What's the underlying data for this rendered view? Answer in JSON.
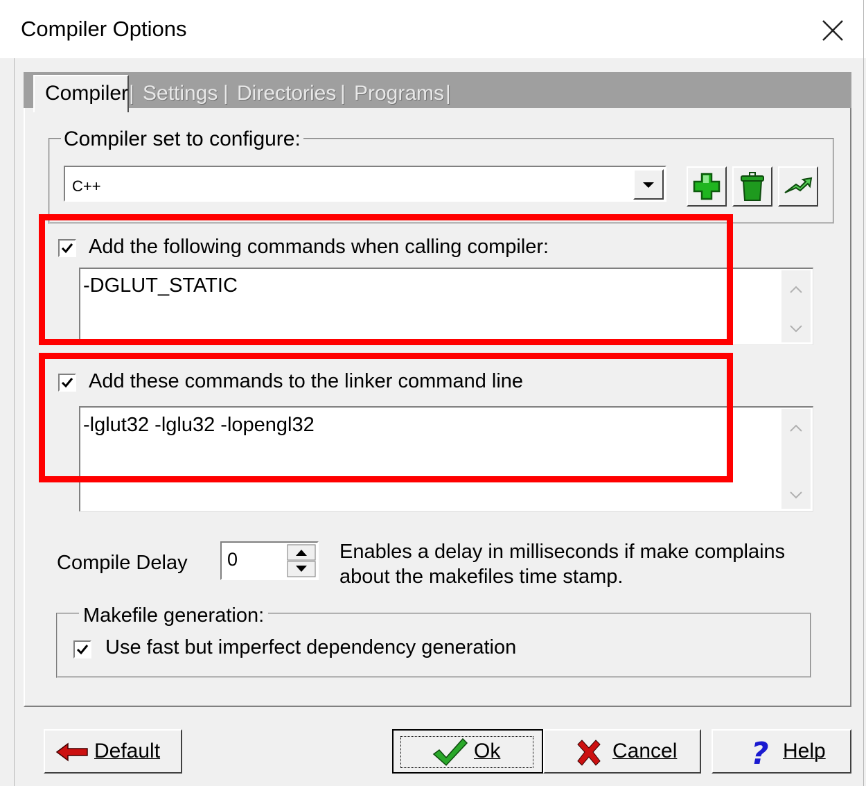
{
  "window": {
    "title": "Compiler Options"
  },
  "tabs": [
    {
      "label": "Compiler",
      "active": true
    },
    {
      "label": "Settings",
      "active": false
    },
    {
      "label": "Directories",
      "active": false
    },
    {
      "label": "Programs",
      "active": false
    }
  ],
  "tab_separator": "|",
  "compiler_set": {
    "label": "Compiler set to configure:",
    "selected": "C++",
    "buttons": {
      "add_icon": "plus-icon",
      "delete_icon": "trash-icon",
      "rename_icon": "rename-arrow-icon"
    }
  },
  "compiler_commands": {
    "checked": true,
    "label": "Add the following commands when calling compiler:",
    "value": "-DGLUT_STATIC"
  },
  "linker_commands": {
    "checked": true,
    "label": "Add these commands to the linker command line",
    "value": "-lglut32 -lglu32 -lopengl32"
  },
  "compile_delay": {
    "label": "Compile Delay",
    "value": "0",
    "description_line1": "Enables a delay in milliseconds if make complains",
    "description_line2": "about the makefiles time stamp."
  },
  "makefile": {
    "label": "Makefile generation:",
    "option_checked": true,
    "option_label": "Use fast but imperfect dependency generation"
  },
  "buttons": {
    "default_label": "Default",
    "ok_label": "Ok",
    "cancel_label": "Cancel",
    "help_label": "Help"
  },
  "colors": {
    "highlight": "#ff0000",
    "add_green": "#1fb51f",
    "help_blue": "#1a1ad0",
    "cancel_red": "#cc1010"
  }
}
